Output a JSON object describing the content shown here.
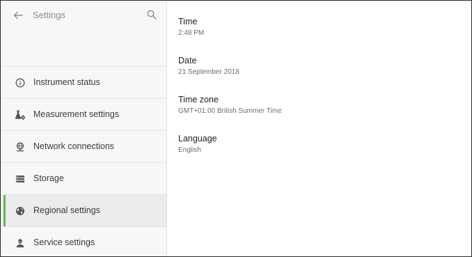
{
  "header": {
    "title": "Settings"
  },
  "sidebar": {
    "items": [
      {
        "label": "Instrument status",
        "icon": "info-icon"
      },
      {
        "label": "Measurement settings",
        "icon": "flask-gear-icon"
      },
      {
        "label": "Network connections",
        "icon": "network-icon"
      },
      {
        "label": "Storage",
        "icon": "storage-icon"
      },
      {
        "label": "Regional settings",
        "icon": "globe-icon",
        "active": true
      },
      {
        "label": "Service settings",
        "icon": "engineer-icon"
      }
    ]
  },
  "content": {
    "settings": [
      {
        "title": "Time",
        "value": "2:48 PM"
      },
      {
        "title": "Date",
        "value": "21 September 2018"
      },
      {
        "title": "Time zone",
        "value": "GMT+01:00 British Summer Time"
      },
      {
        "title": "Language",
        "value": "English"
      }
    ]
  },
  "colors": {
    "accent": "#5fb94d",
    "sidebar_bg": "#f7f7f7",
    "active_bg": "#ececec"
  }
}
